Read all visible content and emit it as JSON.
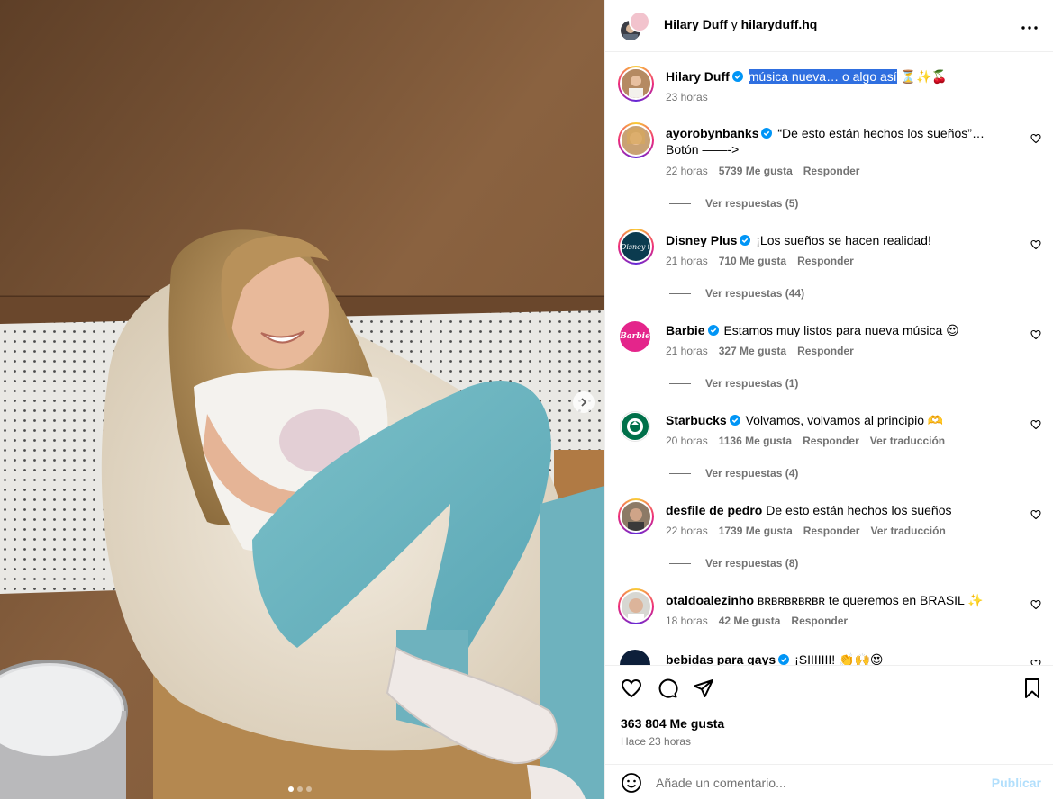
{
  "header": {
    "user_name": "Hilary Duff",
    "connector": "y",
    "collab_name": "hilaryduff.hq",
    "more_icon": "more-horizontal-icon"
  },
  "caption": {
    "username": "Hilary Duff",
    "text": "música nueva… o algo así",
    "emojis": "⏳✨🍒",
    "time": "23 horas"
  },
  "comments": [
    {
      "username": "ayorobynbanks",
      "verified": true,
      "text": "“De esto están hechos los sueños”… Botón ——->",
      "time": "22 horas",
      "likes": "5739 Me gusta",
      "reply": "Responder",
      "translate": "",
      "replies": "Ver respuestas (5)"
    },
    {
      "username": "Disney Plus",
      "verified": true,
      "text": "¡Los sueños se hacen realidad!",
      "time": "21 horas",
      "likes": "710 Me gusta",
      "reply": "Responder",
      "translate": "",
      "replies": "Ver respuestas (44)"
    },
    {
      "username": "Barbie",
      "verified": true,
      "text": "Estamos muy listos para nueva música 😍",
      "time": "21 horas",
      "likes": "327 Me gusta",
      "reply": "Responder",
      "translate": "",
      "replies": "Ver respuestas (1)"
    },
    {
      "username": "Starbucks",
      "verified": true,
      "text": "Volvamos, volvamos al principio 🫶",
      "time": "20 horas",
      "likes": "1136 Me gusta",
      "reply": "Responder",
      "translate": "Ver traducción",
      "replies": "Ver respuestas (4)"
    },
    {
      "username": "desfile de pedro",
      "verified": false,
      "text": "De esto están hechos los sueños",
      "time": "22 horas",
      "likes": "1739 Me gusta",
      "reply": "Responder",
      "translate": "Ver traducción",
      "replies": "Ver respuestas (8)"
    },
    {
      "username": "otaldoalezinho",
      "verified": false,
      "text": "ʙʀʙʀʙʀʙʀʙʀ te queremos en BRASIL ✨",
      "time": "18 horas",
      "likes": "42 Me gusta",
      "reply": "Responder",
      "translate": "",
      "replies": ""
    },
    {
      "username": "bebidas para gays",
      "verified": true,
      "text": "¡SIIIIIII! 👏🙌😍",
      "time": "",
      "likes": "",
      "reply": "",
      "translate": "",
      "replies": ""
    }
  ],
  "avatar_labels": {
    "disney": "Disney+",
    "barbie": "Barbie"
  },
  "actions": {
    "like_icon": "heart-icon",
    "comment_icon": "comment-icon",
    "share_icon": "send-icon",
    "save_icon": "bookmark-icon",
    "likes_count": "363 804 Me gusta",
    "posted_ago": "Hace 23 horas"
  },
  "composer": {
    "emoji_icon": "emoji-icon",
    "placeholder": "Añade un comentario...",
    "post_label": "Publicar"
  },
  "media": {
    "carousel_index": 1,
    "carousel_count": 3
  },
  "colors": {
    "verified": "#0095f6",
    "link_disabled": "#b2dffc",
    "secondary_text": "#737373",
    "selection": "#2f6fe0"
  }
}
